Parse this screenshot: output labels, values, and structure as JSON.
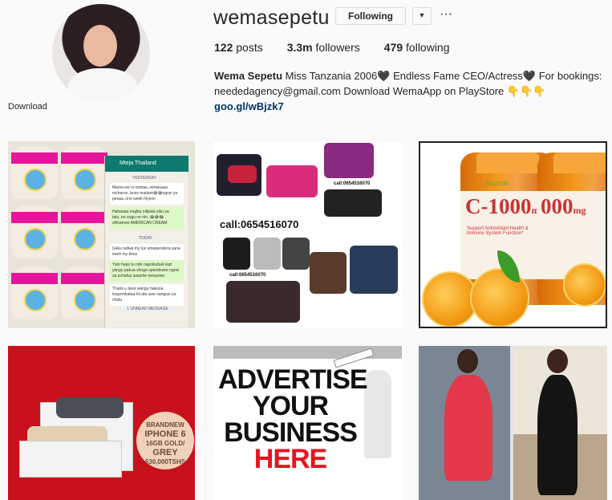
{
  "profile": {
    "username": "wemasepetu",
    "following_button": "Following",
    "dropdown_glyph": "▾",
    "more_glyph": "···",
    "download_label": "Download"
  },
  "stats": {
    "posts_count": "122",
    "posts_label": " posts",
    "followers_count": "3.3m",
    "followers_label": " followers",
    "following_count": "479",
    "following_label": " following"
  },
  "bio": {
    "name": "Wema Sepetu",
    "text": "Miss Tanzania 2006🖤 Endless Fame CEO/Actress🖤 For bookings: neededagency@gmail.com Download WemaApp on PlayStore 👇👇👇",
    "link": "goo.gl/wBjzk7"
  },
  "posts": {
    "p1": {
      "chat_header": "Mteja Thailand",
      "chat_day": "YESTERDAY",
      "msg1": "Mama we ni nomaa..nimekuwa mcharoo..boss madam😂😂ngozi ya pesaa..one week hiyooo",
      "msg2": "Hahaaaa majibu nilipata siku ya tatu..no sugu ne nin..😂😂😂 shikamoo AMERICAN CREAM.",
      "chat_today": "TODAY",
      "msg3": "Ueku nafwa my luv umependeza sana eeeh my boss",
      "msg4": "Yani hapo tu ndo napoikubali kazi yangu pakua shoga upendezee ngozi za uchafuu waache wenyewe",
      "msg5": "Thank u dear wangu hakuna inayemkataa hii ata uwe nangozi ya chatu",
      "unread": "1 UNREAD MESSAGE"
    },
    "p2": {
      "call_small_1": "call:0654516070",
      "call_big": "call:0654516070",
      "call_small_2": "call:0654516070"
    },
    "p3": {
      "brand": "Ascorbic",
      "product": "C-1000",
      "unit": "mg",
      "product_right": "000",
      "desc": "Support Antioxidant Health & Immune System Function*"
    },
    "p4": {
      "seal_line1": "BRANDNEW",
      "seal_line2": "IPHONE 6",
      "seal_line3": "16GB GOLD/",
      "seal_line4": "GREY",
      "seal_line5": "630,000TSHS"
    },
    "p5": {
      "line1": "ADVERTISE",
      "line2": "YOUR",
      "line3": "BUSINESS",
      "line4": "HERE"
    }
  },
  "colors": {
    "link": "#003569",
    "border": "#dbdbdb",
    "text": "#262626"
  }
}
